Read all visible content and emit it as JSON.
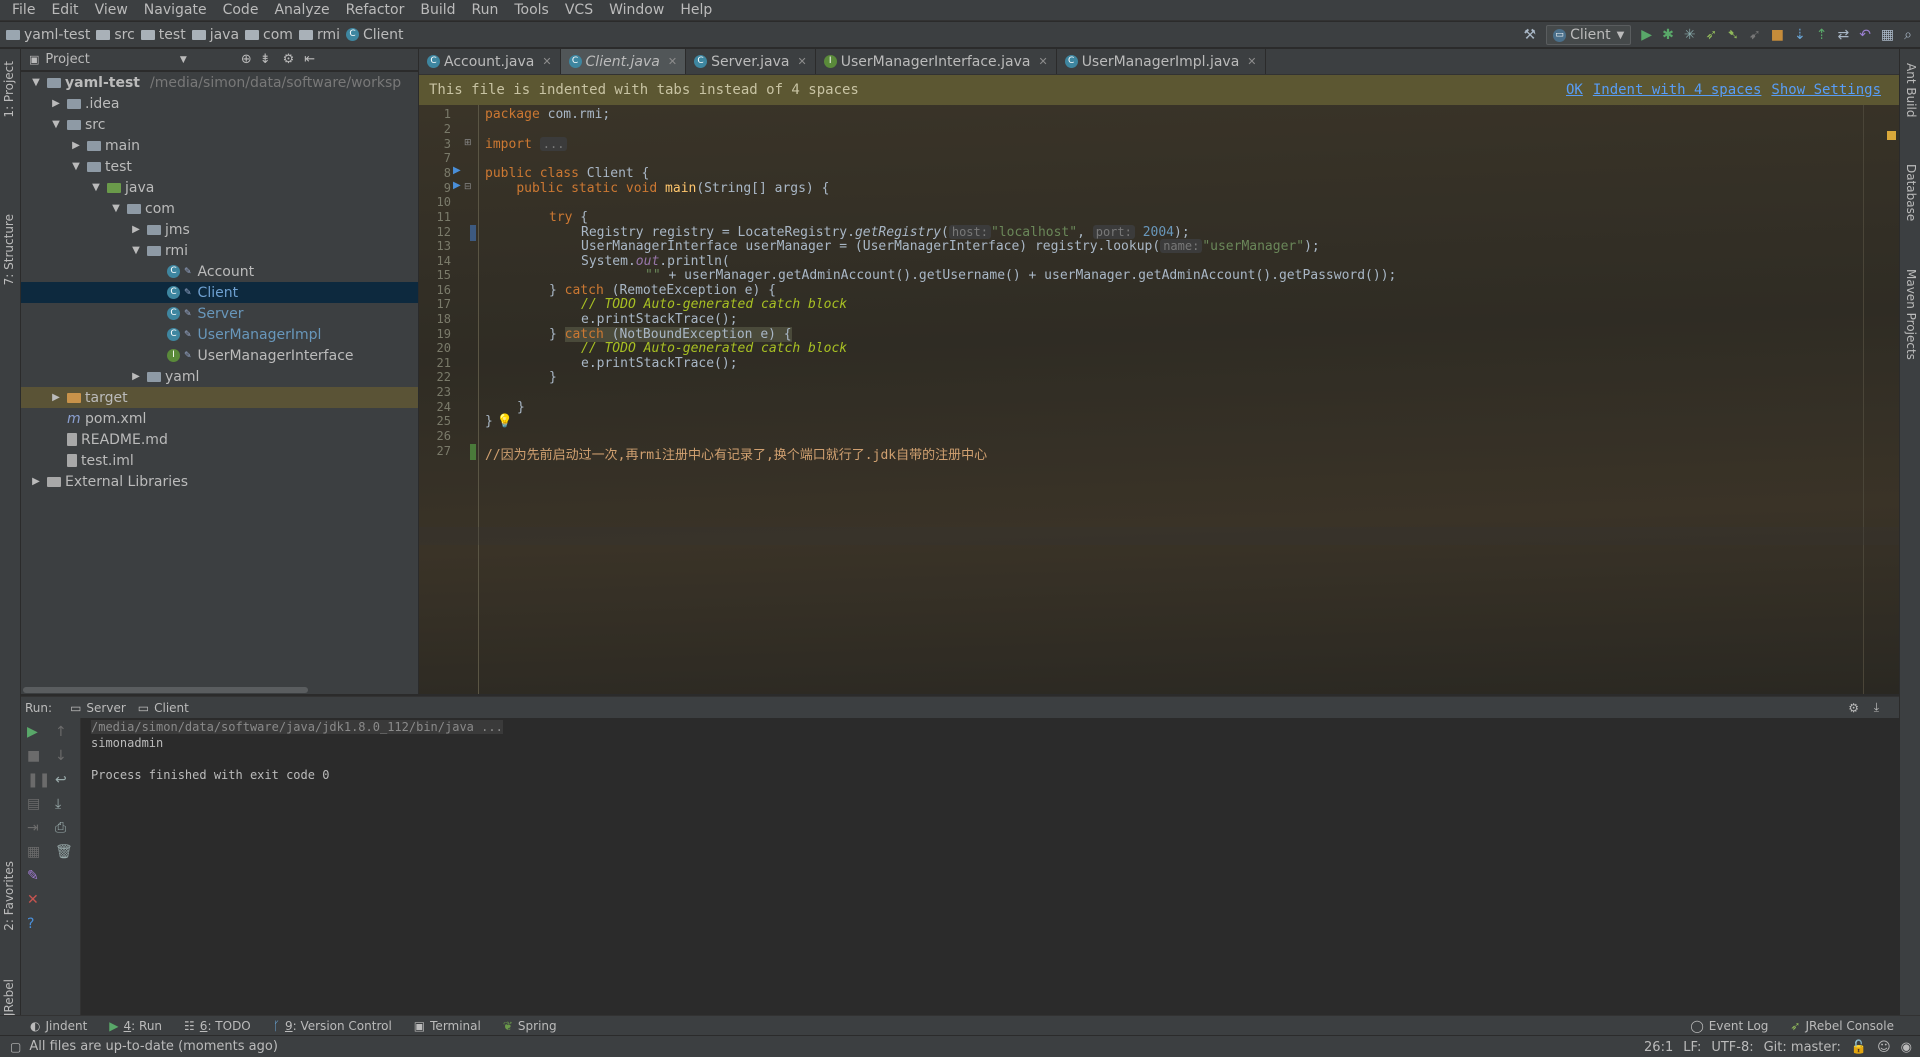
{
  "menu": [
    "File",
    "Edit",
    "View",
    "Navigate",
    "Code",
    "Analyze",
    "Refactor",
    "Build",
    "Run",
    "Tools",
    "VCS",
    "Window",
    "Help"
  ],
  "breadcrumbs": [
    "yaml-test",
    "src",
    "test",
    "java",
    "com",
    "rmi",
    "Client"
  ],
  "run_config": "Client",
  "left_tool_windows": {
    "project": "1: Project",
    "structure": "7: Structure",
    "favorites": "2: Favorites",
    "jrebel": "JRebel"
  },
  "right_tool_windows": {
    "ant": "Ant Build",
    "database": "Database",
    "maven": "Maven Projects"
  },
  "project_panel": {
    "title": "Project",
    "tree": [
      {
        "label": "yaml-test",
        "path": "/media/simon/data/software/worksp",
        "depth": 0,
        "arrow": "down",
        "icon": "folder",
        "style": "bold"
      },
      {
        "label": ".idea",
        "depth": 1,
        "arrow": "right",
        "icon": "folder"
      },
      {
        "label": "src",
        "depth": 1,
        "arrow": "down",
        "icon": "folder"
      },
      {
        "label": "main",
        "depth": 2,
        "arrow": "right",
        "icon": "folder"
      },
      {
        "label": "test",
        "depth": 2,
        "arrow": "down",
        "icon": "folder"
      },
      {
        "label": "java",
        "depth": 3,
        "arrow": "down",
        "icon": "folder-green"
      },
      {
        "label": "com",
        "depth": 4,
        "arrow": "down",
        "icon": "package"
      },
      {
        "label": "jms",
        "depth": 5,
        "arrow": "right",
        "icon": "package"
      },
      {
        "label": "rmi",
        "depth": 5,
        "arrow": "down",
        "icon": "package"
      },
      {
        "label": "Account",
        "depth": 6,
        "icon": "class"
      },
      {
        "label": "Client",
        "depth": 6,
        "icon": "class",
        "style": "blue",
        "selected": true
      },
      {
        "label": "Server",
        "depth": 6,
        "icon": "class",
        "style": "blue"
      },
      {
        "label": "UserManagerImpl",
        "depth": 6,
        "icon": "class",
        "style": "blue"
      },
      {
        "label": "UserManagerInterface",
        "depth": 6,
        "icon": "interface"
      },
      {
        "label": "yaml",
        "depth": 5,
        "arrow": "right",
        "icon": "package"
      },
      {
        "label": "target",
        "depth": 1,
        "arrow": "right",
        "icon": "folder-orange",
        "excluded": true
      },
      {
        "label": "pom.xml",
        "depth": 1,
        "icon": "maven"
      },
      {
        "label": "README.md",
        "depth": 1,
        "icon": "file"
      },
      {
        "label": "test.iml",
        "depth": 1,
        "icon": "file"
      },
      {
        "label": "External Libraries",
        "depth": 0,
        "arrow": "right",
        "icon": "library"
      }
    ]
  },
  "editor_tabs": [
    {
      "label": "Account.java",
      "icon": "class"
    },
    {
      "label": "Client.java",
      "icon": "class",
      "active": true
    },
    {
      "label": "Server.java",
      "icon": "class"
    },
    {
      "label": "UserManagerInterface.java",
      "icon": "interface"
    },
    {
      "label": "UserManagerImpl.java",
      "icon": "class"
    }
  ],
  "notification": {
    "message": "This file is indented with tabs instead of 4 spaces",
    "links": [
      "OK",
      "Indent with 4 spaces",
      "Show Settings"
    ]
  },
  "line_numbers": [
    "1",
    "2",
    "3",
    "7",
    "8",
    "9",
    "10",
    "11",
    "12",
    "13",
    "14",
    "15",
    "16",
    "17",
    "18",
    "19",
    "20",
    "21",
    "22",
    "23",
    "24",
    "25",
    "26",
    "27"
  ],
  "code": {
    "pkg_kw": "package",
    "pkg_name": " com.rmi;",
    "import_kw": "import",
    "import_dots": "...",
    "l8_public": "public",
    "l8_class": "class",
    "l8_name": " Client {",
    "l9_indent": "    ",
    "l9_public": "public",
    "l9_static": "static",
    "l9_void": "void",
    "l9_main": "main",
    "l9_rest": "(String[] args) {",
    "l11_try": "try",
    " l11_brace": " {",
    "l12_a": "Registry registry = LocateRegistry.",
    "l12_m": "getRegistry",
    "l12_b": "(",
    "l12_h1": "host:",
    "l12_s": "\"localhost\"",
    "l12_c": ", ",
    "l12_h2": "port:",
    "l12_n": "2004",
    "l12_e": ");",
    "l13_a": "UserManagerInterface userManager = (UserManagerInterface) registry.lookup(",
    "l13_h": "name:",
    "l13_s": "\"userManager\"",
    "l13_e": ");",
    "l14_a": "System.",
    "l14_f": "out",
    "l14_b": ".println(",
    "l15_s": "\"\"",
    "l15_rest": " + userManager.getAdminAccount().getUsername() + userManager.getAdminAccount().getPassword());",
    "l16_a": "} ",
    "l16_catch": "catch",
    "l16_rest": " (RemoteException e) {",
    "l17": "// TODO Auto-generated catch block",
    "l18": "e.printStackTrace();",
    "l19_a": "} ",
    "l19_catch": "catch",
    "l19_rest": " (NotBoundException e) {",
    "l20": "// TODO Auto-generated catch block",
    "l21": "e.printStackTrace();",
    "l22": "}",
    "l24": "}",
    "l25": "}",
    "l27": "//因为先前启动过一次,再rmi注册中心有记录了,换个端口就行了.jdk自带的注册中心"
  },
  "run_panel": {
    "label": "Run:",
    "tabs": [
      "Server",
      "Client"
    ],
    "console": [
      "/media/simon/data/software/java/jdk1.8.0_112/bin/java ...",
      "simonadmin",
      "",
      "Process finished with exit code 0"
    ]
  },
  "bottom_tabs": [
    {
      "label": "Jindent"
    },
    {
      "num": "4",
      "label": ": Run"
    },
    {
      "num": "6",
      "label": ": TODO"
    },
    {
      "num": "9",
      "label": ": Version Control"
    },
    {
      "label": "Terminal"
    },
    {
      "label": "Spring"
    }
  ],
  "bottom_right_tabs": [
    "Event Log",
    "JRebel Console"
  ],
  "status": {
    "message": "All files are up-to-date (moments ago)",
    "position": "26:1",
    "line_sep": "LF:",
    "encoding": "UTF-8:",
    "git": "Git: master:"
  },
  "colors": {
    "keyword": "#cc7832",
    "string": "#6a8759",
    "number": "#6897bb",
    "function": "#ffc66d",
    "comment": "#808080",
    "todo": "#a8c023",
    "selection": "#0d293e",
    "notice": "#5c5732"
  }
}
